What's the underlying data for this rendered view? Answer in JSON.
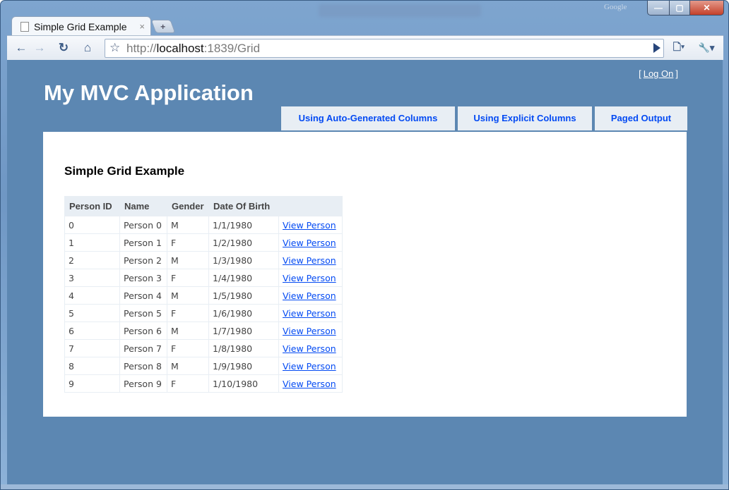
{
  "browser": {
    "tab_title": "Simple Grid Example",
    "tab_close": "×",
    "new_tab": "+",
    "url_scheme": "http://",
    "url_host": "localhost",
    "url_rest": ":1839/Grid",
    "google_mark": "Google",
    "window_buttons": {
      "minimize": "—",
      "maximize": "▢",
      "close": "✕"
    },
    "icons": {
      "back": "←",
      "forward": "→",
      "reload": "↻",
      "home": "⌂",
      "star": "☆",
      "page_menu": "🗋▾",
      "wrench": "🔧▾"
    }
  },
  "header": {
    "app_title": "My MVC Application",
    "logon_open": "[",
    "logon_label": "Log On",
    "logon_close": "]"
  },
  "menu": [
    {
      "label": "Using Auto-Generated Columns"
    },
    {
      "label": "Using Explicit Columns"
    },
    {
      "label": "Paged Output"
    }
  ],
  "main": {
    "heading": "Simple Grid Example",
    "columns": [
      "Person ID",
      "Name",
      "Gender",
      "Date Of Birth",
      ""
    ],
    "rows": [
      {
        "id": "0",
        "name": "Person 0",
        "gender": "M",
        "dob": "1/1/1980",
        "link": "View Person"
      },
      {
        "id": "1",
        "name": "Person 1",
        "gender": "F",
        "dob": "1/2/1980",
        "link": "View Person"
      },
      {
        "id": "2",
        "name": "Person 2",
        "gender": "M",
        "dob": "1/3/1980",
        "link": "View Person"
      },
      {
        "id": "3",
        "name": "Person 3",
        "gender": "F",
        "dob": "1/4/1980",
        "link": "View Person"
      },
      {
        "id": "4",
        "name": "Person 4",
        "gender": "M",
        "dob": "1/5/1980",
        "link": "View Person"
      },
      {
        "id": "5",
        "name": "Person 5",
        "gender": "F",
        "dob": "1/6/1980",
        "link": "View Person"
      },
      {
        "id": "6",
        "name": "Person 6",
        "gender": "M",
        "dob": "1/7/1980",
        "link": "View Person"
      },
      {
        "id": "7",
        "name": "Person 7",
        "gender": "F",
        "dob": "1/8/1980",
        "link": "View Person"
      },
      {
        "id": "8",
        "name": "Person 8",
        "gender": "M",
        "dob": "1/9/1980",
        "link": "View Person"
      },
      {
        "id": "9",
        "name": "Person 9",
        "gender": "F",
        "dob": "1/10/1980",
        "link": "View Person"
      }
    ]
  },
  "colors": {
    "page_background": "#5c87b2",
    "menu_background": "#e8eef4",
    "link": "#034af3",
    "header_text": "#ffffff"
  }
}
